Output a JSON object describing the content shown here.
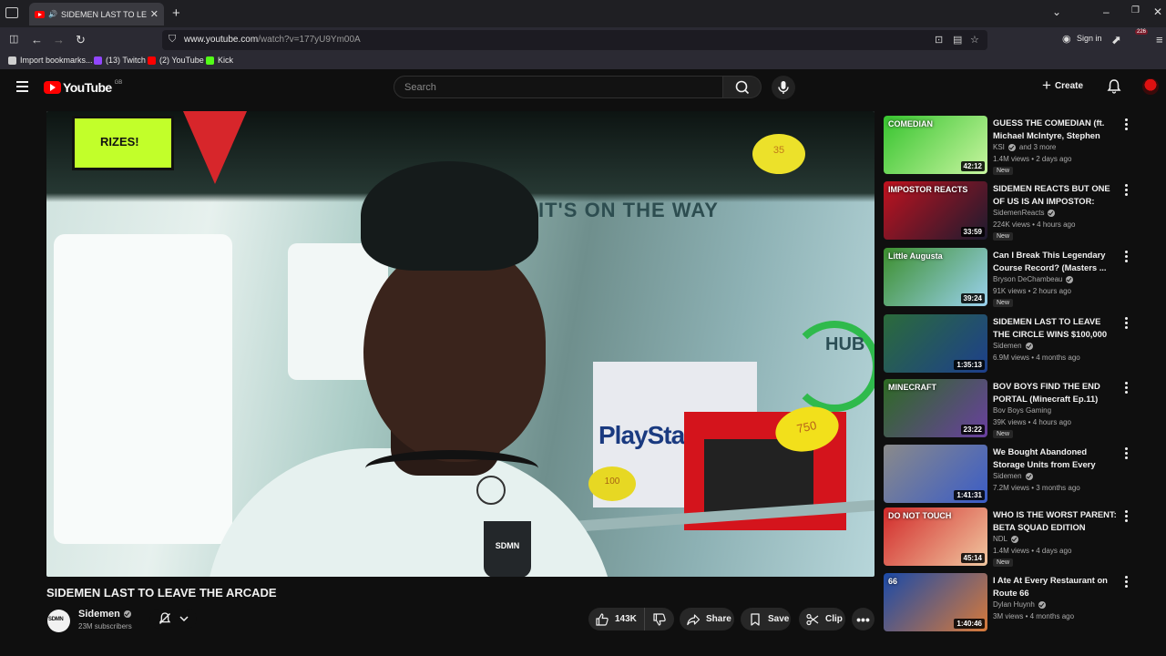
{
  "browser": {
    "tab_title": "SIDEMEN LAST TO LEAVE T",
    "url_host": "www.youtube.com",
    "url_path": "/watch?v=177yU9Ym00A",
    "signin_label": "Sign in",
    "extensions_badge": "226",
    "bookmarks": [
      {
        "label": "Import bookmarks...",
        "icon": "folder-icon",
        "color": "#cfcfcf"
      },
      {
        "label": "(13) Twitch",
        "icon": "twitch-icon",
        "color": "#9146ff"
      },
      {
        "label": "(2) YouTube",
        "icon": "youtube-icon",
        "color": "#ff0000"
      },
      {
        "label": "Kick",
        "icon": "kick-icon",
        "color": "#53fc18"
      }
    ]
  },
  "youtube": {
    "logo_text": "YouTube",
    "country_code": "GB",
    "search_placeholder": "Search",
    "create_label": "Create"
  },
  "player": {
    "sign_text": "RIZES!",
    "marquee_text": "IT'S ON THE WAY",
    "console_text": "PlaySta",
    "price_main": "750",
    "price_top": "35",
    "price_small": "100",
    "patch_text": "SDMN",
    "hub_text": "HUB"
  },
  "video": {
    "title": "SIDEMEN LAST TO LEAVE THE ARCADE",
    "channel": "Sidemen",
    "subscribers": "23M subscribers",
    "likes": "143K",
    "share_label": "Share",
    "save_label": "Save",
    "clip_label": "Clip"
  },
  "recommendations": [
    {
      "title": "GUESS THE COMEDIAN (ft. Michael McIntyre, Stephen Tri...",
      "channel": "KSI",
      "channel_suffix": "and 3 more",
      "meta": "1.4M views • 2 days ago",
      "badge": "New",
      "duration": "42:12",
      "thumb_colors": [
        "#37c42f",
        "#c8f5a0"
      ],
      "thumb_label": "COMEDIAN",
      "verified": true
    },
    {
      "title": "SIDEMEN REACTS BUT ONE OF US IS AN IMPOSTOR: TIKTOK ...",
      "channel": "SidemenReacts",
      "channel_suffix": "",
      "meta": "224K views • 4 hours ago",
      "badge": "New",
      "duration": "33:59",
      "thumb_colors": [
        "#c1121f",
        "#1b1b2f"
      ],
      "thumb_label": "IMPOSTOR REACTS",
      "verified": true
    },
    {
      "title": "Can I Break This Legendary Course Record? (Masters ...",
      "channel": "Bryson DeChambeau",
      "channel_suffix": "",
      "meta": "91K views • 2 hours ago",
      "badge": "New",
      "duration": "39:24",
      "thumb_colors": [
        "#3c8f2d",
        "#9ad1ee"
      ],
      "thumb_label": "Little Augusta",
      "verified": true
    },
    {
      "title": "SIDEMEN LAST TO LEAVE THE CIRCLE WINS $100,000",
      "channel": "Sidemen",
      "channel_suffix": "",
      "meta": "6.9M views • 4 months ago",
      "badge": "",
      "duration": "1:35:13",
      "thumb_colors": [
        "#2b6b3a",
        "#1d3f8c"
      ],
      "thumb_label": "",
      "verified": true
    },
    {
      "title": "BOV BOYS FIND THE END PORTAL (Minecraft Ep.11)",
      "channel": "Bov Boys Gaming",
      "channel_suffix": "",
      "meta": "39K views • 4 hours ago",
      "badge": "New",
      "duration": "23:22",
      "thumb_colors": [
        "#2d6b22",
        "#6a3fa0"
      ],
      "thumb_label": "MINECRAFT",
      "verified": false
    },
    {
      "title": "We Bought Abandoned Storage Units from Every Continent an...",
      "channel": "Sidemen",
      "channel_suffix": "",
      "meta": "7.2M views • 3 months ago",
      "badge": "",
      "duration": "1:41:31",
      "thumb_colors": [
        "#8a8a8a",
        "#3a5cc7"
      ],
      "thumb_label": "",
      "verified": true
    },
    {
      "title": "WHO IS THE WORST PARENT: BETA SQUAD EDITION",
      "channel": "NDL",
      "channel_suffix": "",
      "meta": "1.4M views • 4 days ago",
      "badge": "New",
      "duration": "45:14",
      "thumb_colors": [
        "#d22a2a",
        "#f0c7a0"
      ],
      "thumb_label": "DO NOT TOUCH",
      "verified": true
    },
    {
      "title": "I Ate At Every Restaurant on Route 66",
      "channel": "Dylan Huynh",
      "channel_suffix": "",
      "meta": "3M views • 4 months ago",
      "badge": "",
      "duration": "1:40:46",
      "thumb_colors": [
        "#1a4aa8",
        "#d87a3a"
      ],
      "thumb_label": "66",
      "verified": true
    }
  ]
}
